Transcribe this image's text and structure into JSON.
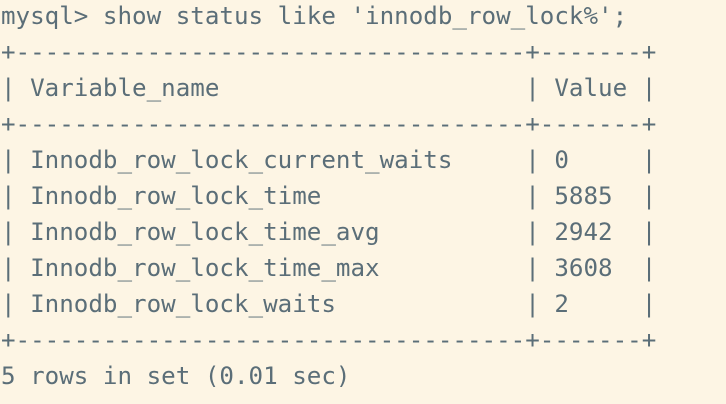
{
  "terminal": {
    "prompt": "mysql> show status like 'innodb_row_lock%';",
    "separator": "+-----------------------------------+-------+",
    "header": "| Variable_name                     | Value |",
    "rows": [
      "| Innodb_row_lock_current_waits     | 0     |",
      "| Innodb_row_lock_time              | 5885  |",
      "| Innodb_row_lock_time_avg          | 2942  |",
      "| Innodb_row_lock_time_max          | 3608  |",
      "| Innodb_row_lock_waits             | 2     |"
    ],
    "footer": "5 rows in set (0.01 sec)"
  },
  "colors": {
    "background": "#fdf5e4",
    "text": "#5b6e78"
  }
}
